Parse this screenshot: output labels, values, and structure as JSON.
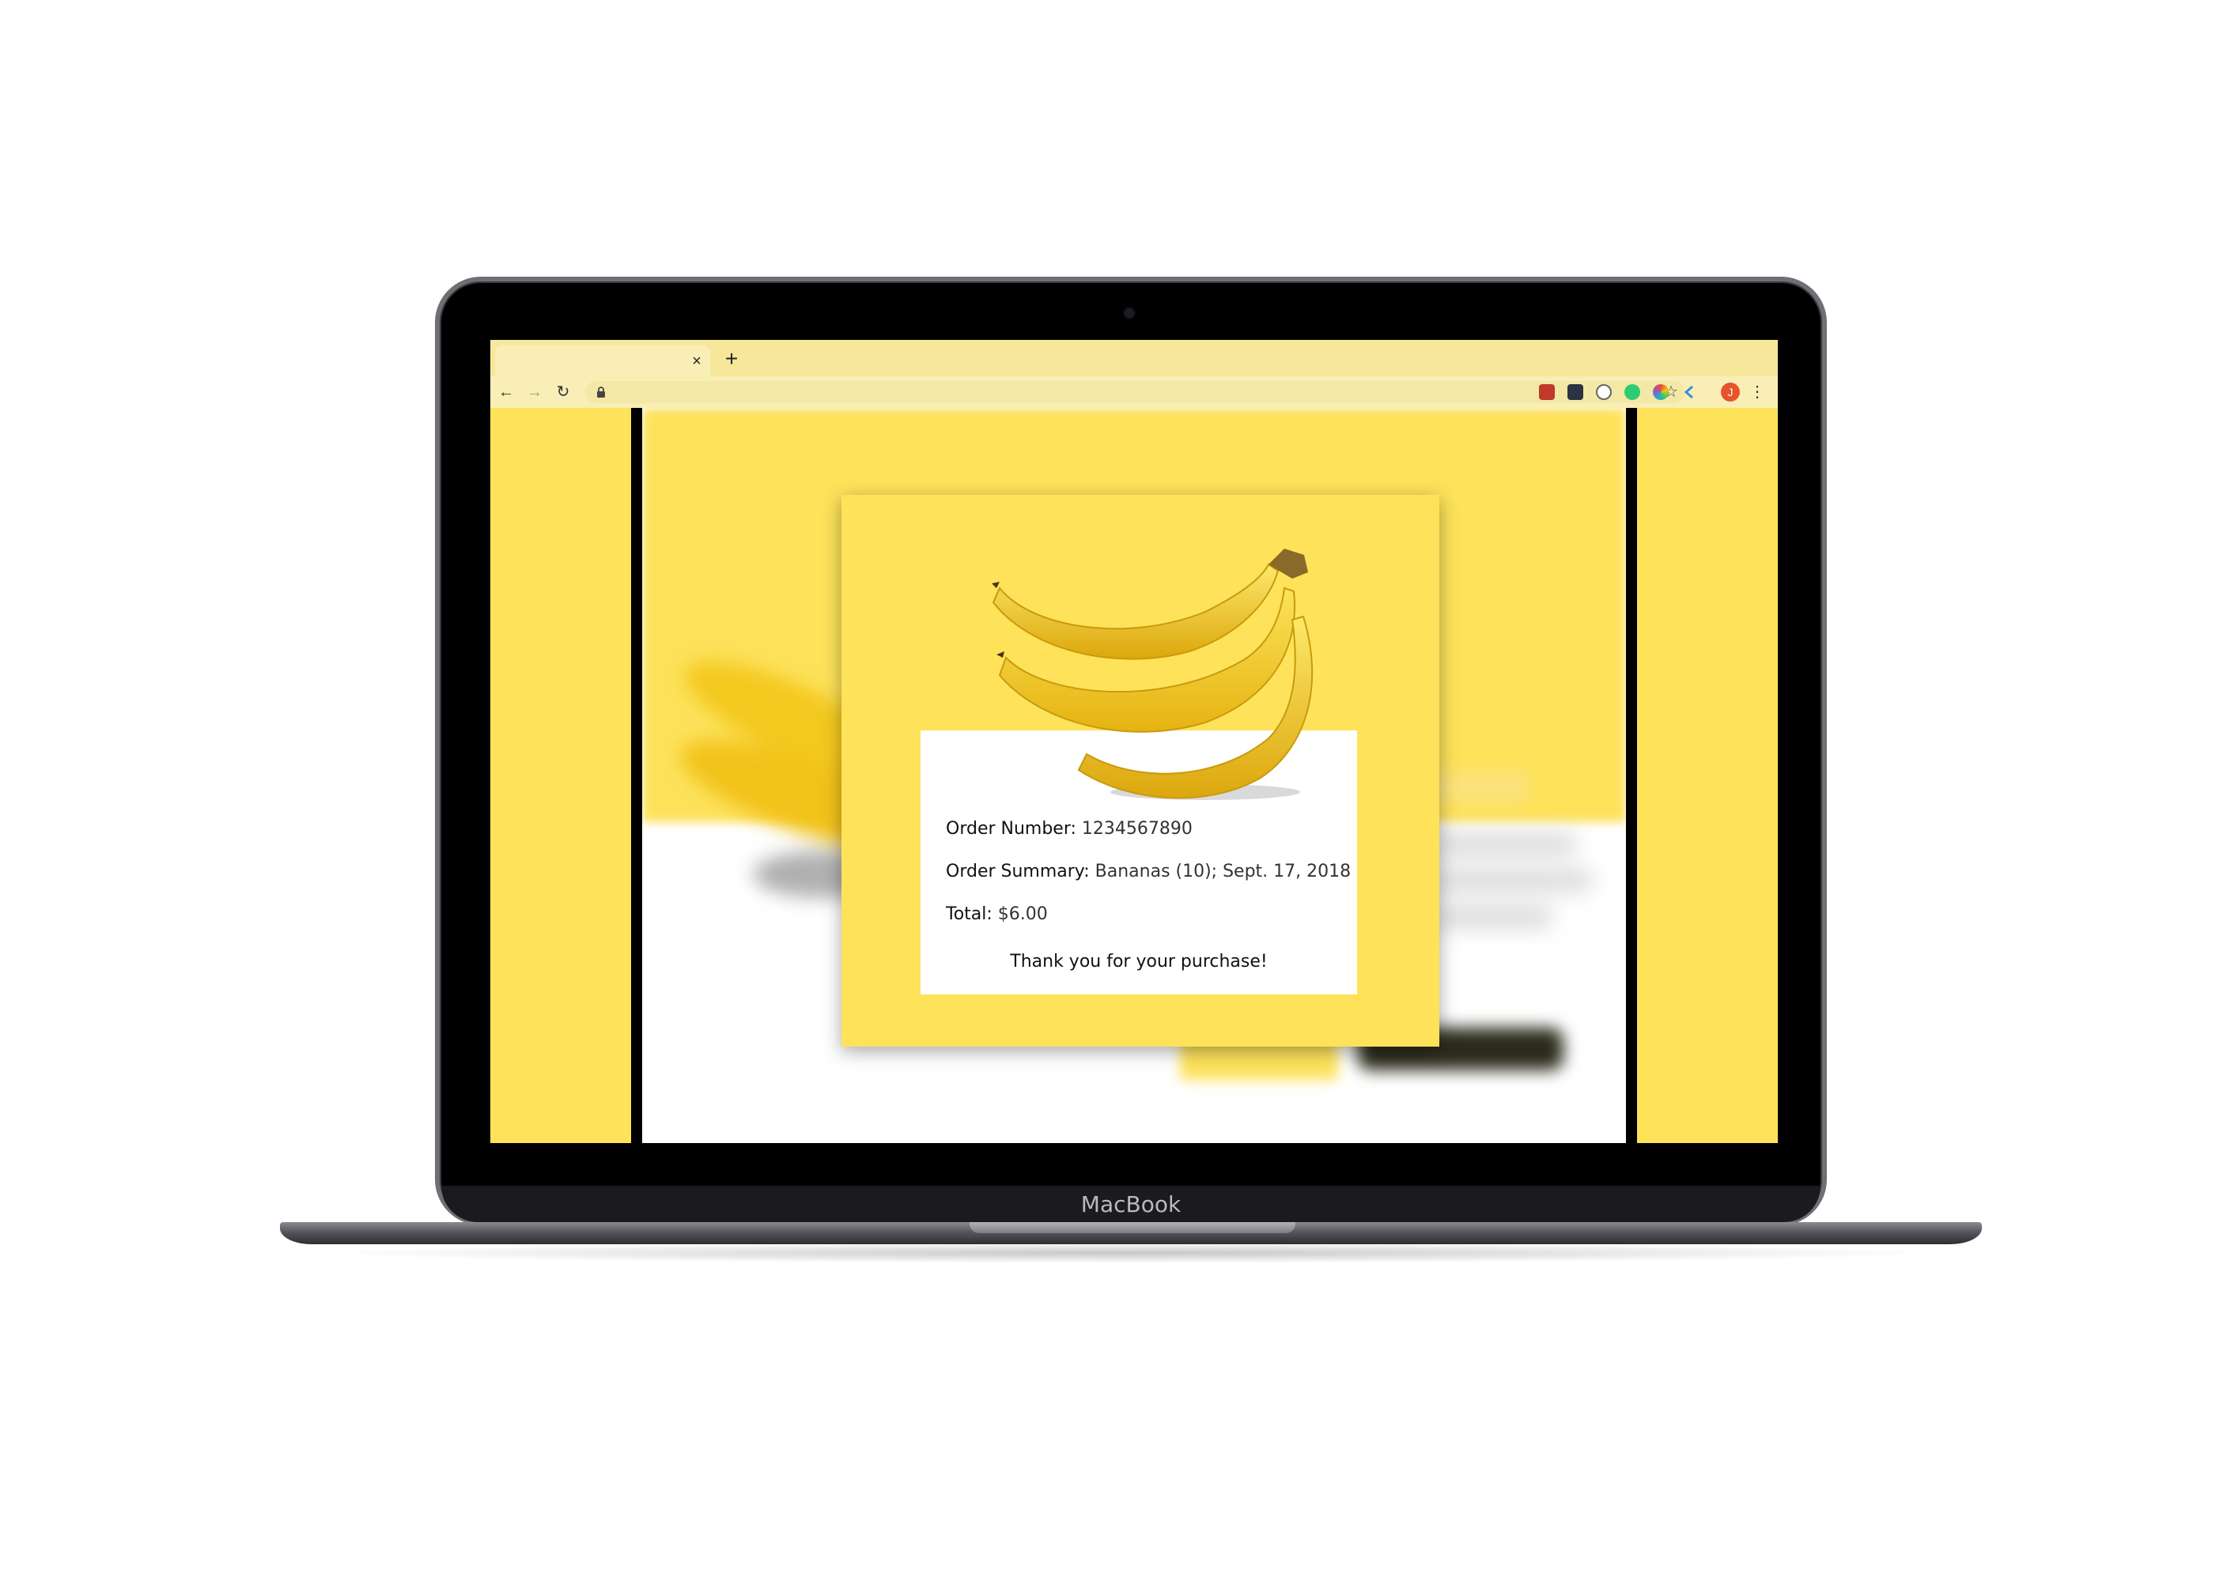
{
  "device": {
    "brand_label": "MacBook"
  },
  "browser": {
    "tab_close_glyph": "×",
    "new_tab_glyph": "+",
    "back_glyph": "←",
    "forward_glyph": "→",
    "reload_glyph": "↻",
    "bookmark_glyph": "☆",
    "menu_glyph": "⋮",
    "profile_initial": "J",
    "extensions": [
      "extension-red-icon",
      "extension-dark-icon",
      "extension-face-icon",
      "extension-green-icon",
      "extension-color-wheel-icon",
      "extension-arrow-icon"
    ]
  },
  "order": {
    "number_label": "Order Number:",
    "number_value": "1234567890",
    "summary_label": "Order Summary:",
    "summary_value": "Bananas (10); Sept. 17, 2018",
    "total_label": "Total:",
    "total_value": "$6.00",
    "thanks": "Thank you for your purchase!"
  },
  "colors": {
    "accent_yellow": "#fde25a",
    "browser_chrome": "#f6e79a",
    "profile_avatar": "#e8532c"
  }
}
